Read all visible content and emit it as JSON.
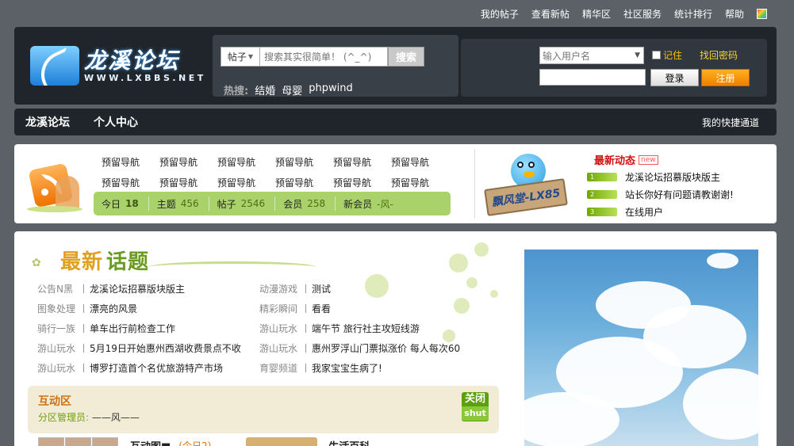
{
  "toplinks": [
    "我的帖子",
    "查看新帖",
    "精华区",
    "社区服务",
    "统计排行",
    "帮助"
  ],
  "logo": {
    "cn": "龙溪论坛",
    "en": "WWW.LXBBS.NET"
  },
  "search": {
    "category": "帖子",
    "placeholder": "搜索其实很简单！ (^_^)",
    "button": "搜索",
    "hot_label": "热搜:",
    "hot": [
      "结婚",
      "母婴",
      "phpwind"
    ]
  },
  "login": {
    "username_placeholder": "输入用户名",
    "remember": "记住",
    "forgot": "找回密码",
    "login_button": "登录",
    "register_button": "注册"
  },
  "nav": {
    "items": [
      "龙溪论坛",
      "个人中心"
    ],
    "quick": "我的快捷通道"
  },
  "reserved_nav": [
    "预留导航",
    "预留导航",
    "预留导航",
    "预留导航",
    "预留导航",
    "预留导航",
    "预留导航",
    "预留导航",
    "预留导航",
    "预留导航",
    "预留导航",
    "预留导航"
  ],
  "stats": [
    {
      "label": "今日",
      "value": "18"
    },
    {
      "label": "主题",
      "value": "456"
    },
    {
      "label": "帖子",
      "value": "2546"
    },
    {
      "label": "会员",
      "value": "258"
    },
    {
      "label": "新会员",
      "value": "-风-"
    }
  ],
  "mascot_sign": "飘风堂-LX85",
  "news": {
    "title": "最新动态",
    "new_tag": "new",
    "items": [
      "龙溪论坛招慕版块版主",
      "站长你好有问题请教谢谢!",
      "在线用户"
    ]
  },
  "topics": {
    "title_part1": "最新",
    "title_part2": "话题",
    "rows": [
      [
        {
          "cat": "公告N黑",
          "title": "龙溪论坛招慕版块版主"
        },
        {
          "cat": "动漫游戏",
          "title": "测试"
        }
      ],
      [
        {
          "cat": "图象处理",
          "title": "漂亮的风景"
        },
        {
          "cat": "精彩瞬间",
          "title": "看看"
        }
      ],
      [
        {
          "cat": "骑行一族",
          "title": "单车出行前检查工作"
        },
        {
          "cat": "游山玩水",
          "title": "端午节 旅行社主攻短线游"
        }
      ],
      [
        {
          "cat": "游山玩水",
          "title": "5月19日开始惠州西湖收费景点不收"
        },
        {
          "cat": "游山玩水",
          "title": "惠州罗浮山门票拟涨价 每人每次60"
        }
      ],
      [
        {
          "cat": "游山玩水",
          "title": "博罗打造首个名优旅游特产市场"
        },
        {
          "cat": "育婴频道",
          "title": "我家宝宝生病了!"
        }
      ]
    ]
  },
  "zone": {
    "title": "互动区",
    "manager_label": "分区管理员:",
    "manager": "——风——",
    "close_cn": "关闭",
    "close_en": "shut"
  },
  "zone_rows": {
    "forum1": "互动图■",
    "forum1_today": "(今日2)",
    "forum2": "生活百科"
  },
  "colors": {
    "accent_orange": "#f08000",
    "accent_green": "#a9d26a",
    "header_bg": "#1f252b"
  }
}
